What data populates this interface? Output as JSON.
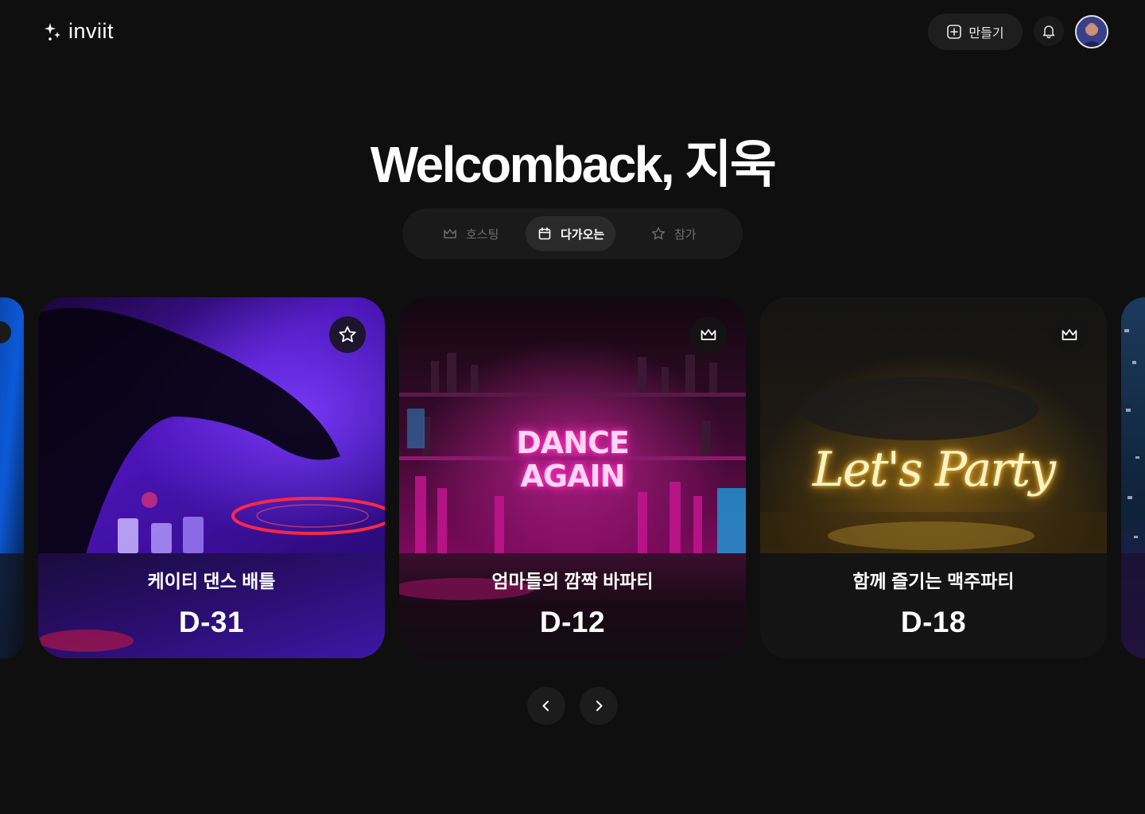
{
  "header": {
    "logo_text": "inviit",
    "create_label": "만들기"
  },
  "welcome": {
    "title": "Welcomback, 지욱"
  },
  "tabs": [
    {
      "label": "호스팅",
      "icon": "crown-icon",
      "active": false
    },
    {
      "label": "다가오는",
      "icon": "calendar-icon",
      "active": true
    },
    {
      "label": "참가",
      "icon": "star-icon",
      "active": false
    }
  ],
  "cards": [
    {
      "title": "케이티 댄스 배틀",
      "dday": "D-31",
      "badge_icon": "star-icon"
    },
    {
      "title": "엄마들의 깜짝 바파티",
      "dday": "D-12",
      "badge_icon": "crown-icon",
      "neon_line1": "DANCE",
      "neon_line2": "AGAIN"
    },
    {
      "title": "함께 즐기는 맥주파티",
      "dday": "D-18",
      "badge_icon": "crown-icon",
      "neon_text": "Let's Party"
    }
  ],
  "colors": {
    "background": "#0f0f0f",
    "surface": "#1a1a1a",
    "active_tab": "#2a2a2a",
    "purple": "#6a1fd6",
    "neon_pink": "#ff2fbd",
    "neon_gold": "#ffce4a"
  }
}
